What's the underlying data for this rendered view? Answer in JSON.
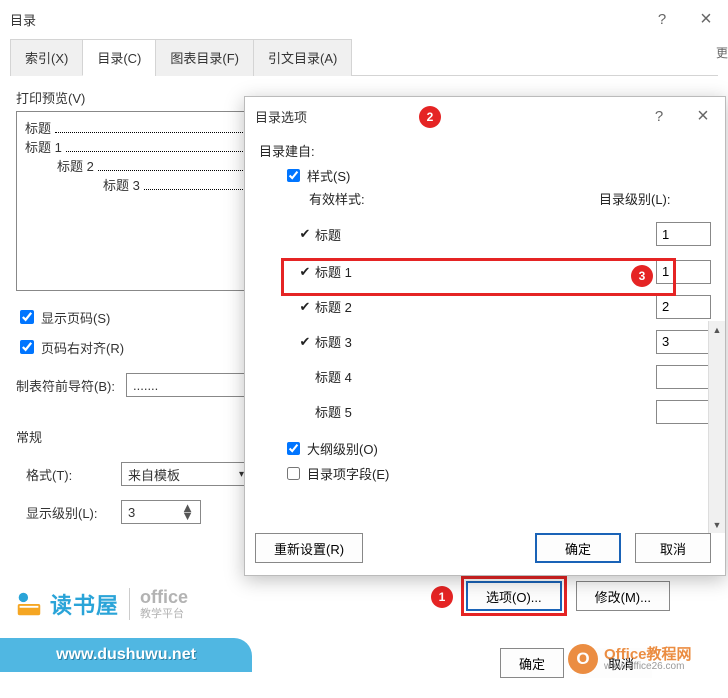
{
  "dialog1": {
    "title": "目录",
    "help": "?",
    "close": "×",
    "tabs": {
      "index": "索引(X)",
      "toc": "目录(C)",
      "figures": "图表目录(F)",
      "citations": "引文目录(A)"
    },
    "preview_label": "打印预览(V)",
    "preview": {
      "l1": "标题",
      "l2": "标题 1",
      "l3": "标题 2",
      "l4": "标题 3"
    },
    "show_page_numbers": "显示页码(S)",
    "right_align": "页码右对齐(R)",
    "tab_leader_label": "制表符前导符(B):",
    "tab_leader_value": ".......",
    "general_section": "常规",
    "format_label": "格式(T):",
    "format_value": "来自模板",
    "show_levels_label": "显示级别(L):",
    "show_levels_value": "3",
    "options_btn": "选项(O)...",
    "modify_btn": "修改(M)...",
    "ok": "确定",
    "cancel": "取消",
    "extra_edge": "更"
  },
  "dialog2": {
    "title": "目录选项",
    "help": "?",
    "close": "×",
    "build_from": "目录建自:",
    "styles_chk": "样式(S)",
    "valid_styles": "有效样式:",
    "toc_level": "目录级别(L):",
    "rows": [
      {
        "checked": true,
        "name": "标题",
        "level": "1"
      },
      {
        "checked": true,
        "name": "标题 1",
        "level": "1"
      },
      {
        "checked": true,
        "name": "标题 2",
        "level": "2"
      },
      {
        "checked": true,
        "name": "标题 3",
        "level": "3"
      },
      {
        "checked": false,
        "name": "标题 4",
        "level": ""
      },
      {
        "checked": false,
        "name": "标题 5",
        "level": ""
      }
    ],
    "outline_level": "大纲级别(O)",
    "toc_fields": "目录项字段(E)",
    "reset": "重新设置(R)",
    "ok": "确定",
    "cancel": "取消"
  },
  "badges": {
    "b1": "1",
    "b2": "2",
    "b3": "3"
  },
  "watermark": {
    "dushuwu": "读书屋",
    "office1": "office",
    "office2": "教学平台",
    "url": "www.dushuwu.net",
    "ofc_logo": "O",
    "ofc_l1": "Office教程网",
    "ofc_l2": "www.office26.com"
  }
}
